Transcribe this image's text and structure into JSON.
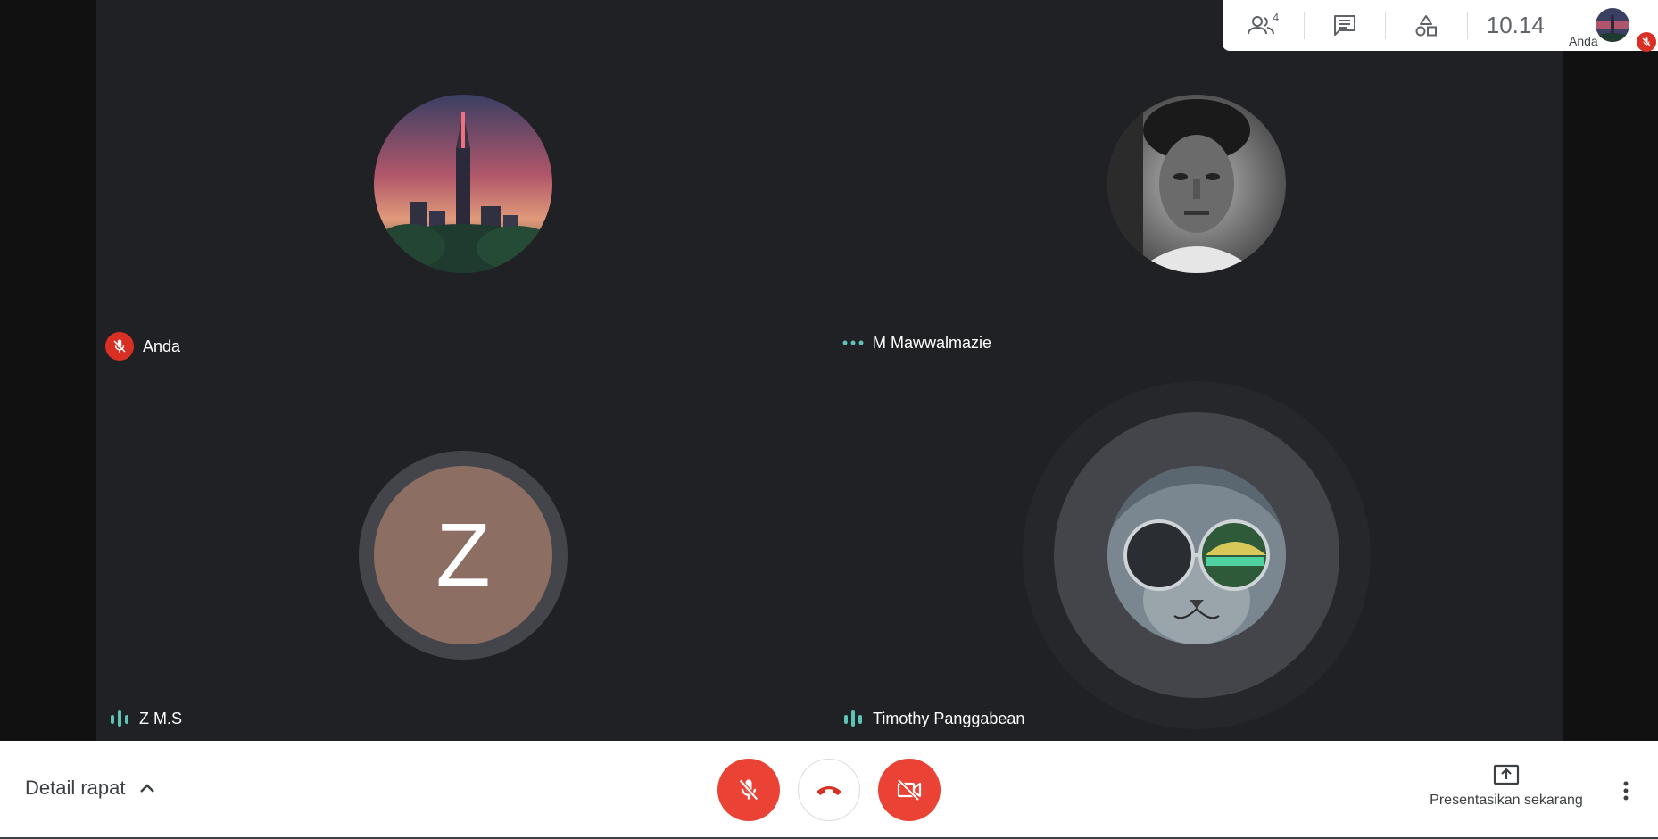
{
  "topbar": {
    "participants_count": "4",
    "clock": "10.14"
  },
  "self_preview": {
    "name": "Anda"
  },
  "participants": [
    {
      "name": "Anda",
      "status": "muted"
    },
    {
      "name": "M Mawwalmazie",
      "status": "connecting"
    },
    {
      "name": "Z M.S",
      "status": "speaking",
      "initial": "Z",
      "avatar_color": "#8d6e63"
    },
    {
      "name": "Timothy Panggabean",
      "status": "speaking"
    }
  ],
  "bottombar": {
    "details_label": "Detail rapat",
    "present_label": "Presentasikan sekarang"
  },
  "colors": {
    "stage_bg": "#202124",
    "danger": "#ea4335",
    "speaking": "#5ec2b7"
  }
}
